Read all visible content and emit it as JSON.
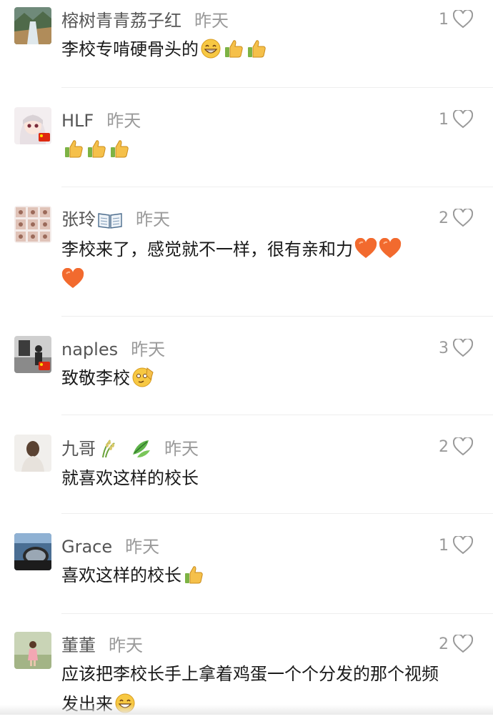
{
  "comments": [
    {
      "name": "榕树青青荔子红",
      "time": "昨天",
      "likes": "1",
      "text": "李校专啃硬骨头的",
      "emojis": [
        "grin-emoji",
        "thumbs-up-emoji",
        "thumbs-up-emoji"
      ],
      "avatar": "landscape",
      "flag": false
    },
    {
      "name": "HLF",
      "time": "昨天",
      "likes": "1",
      "text": "",
      "emojis": [
        "thumbs-up-emoji",
        "thumbs-up-emoji",
        "thumbs-up-emoji"
      ],
      "avatar": "anime-girl",
      "flag": true
    },
    {
      "name": "张玲",
      "time": "昨天",
      "likes": "2",
      "text": "李校来了，感觉就不一样，很有亲和力",
      "emojis": [
        "orange-heart-emoji",
        "orange-heart-emoji",
        "orange-heart-emoji"
      ],
      "avatar": "photo-grid",
      "flag": false,
      "name_emojis": [
        "book-emoji"
      ]
    },
    {
      "name": "naples",
      "time": "昨天",
      "likes": "3",
      "text": "致敬李校",
      "emojis": [
        "salute-emoji"
      ],
      "avatar": "bw-photo",
      "flag": true
    },
    {
      "name": "九哥",
      "time": "昨天",
      "likes": "2",
      "text": "就喜欢这样的校长",
      "emojis": [],
      "avatar": "girl-back",
      "flag": false,
      "name_emojis": [
        "rice-plant-emoji",
        "herb-emoji"
      ]
    },
    {
      "name": "Grace",
      "time": "昨天",
      "likes": "1",
      "text": "喜欢这样的校长",
      "emojis": [
        "thumbs-up-emoji"
      ],
      "avatar": "car-mirror",
      "flag": false
    },
    {
      "name": "董董",
      "time": "昨天",
      "likes": "2",
      "text": "应该把李校长手上拿着鸡蛋一个个分发的那个视频发出来",
      "emojis": [
        "grin-emoji"
      ],
      "avatar": "child-outdoor",
      "flag": false
    }
  ],
  "icons": {
    "like": "heart-outline-icon"
  },
  "colors": {
    "name": "#555555",
    "time": "#9a9a9a",
    "text": "#1a1a1a",
    "heart": "#999999"
  }
}
